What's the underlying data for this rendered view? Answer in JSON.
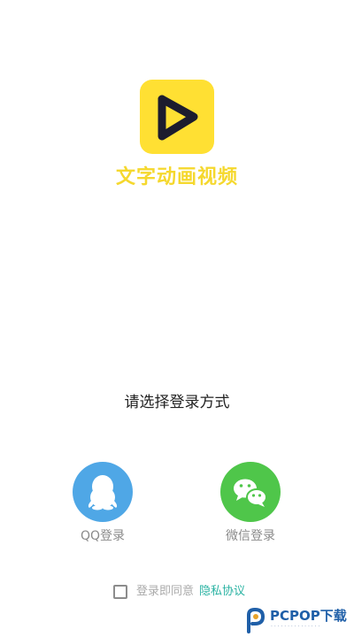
{
  "app": {
    "name": "文字动画视频",
    "logo_icon": "play-triangle-icon",
    "logo_color": "#FFE033",
    "name_color": "#F5D82E"
  },
  "login": {
    "prompt": "请选择登录方式",
    "options": [
      {
        "label": "QQ登录",
        "icon": "qq-penguin-icon",
        "color": "#4FA7E6"
      },
      {
        "label": "微信登录",
        "icon": "wechat-icon",
        "color": "#4FC64A"
      }
    ]
  },
  "agreement": {
    "text": "登录即同意",
    "link": "隐私协议",
    "link_color": "#2BB3A3",
    "checked": false
  },
  "watermark": {
    "text": "PCPOP下载"
  }
}
